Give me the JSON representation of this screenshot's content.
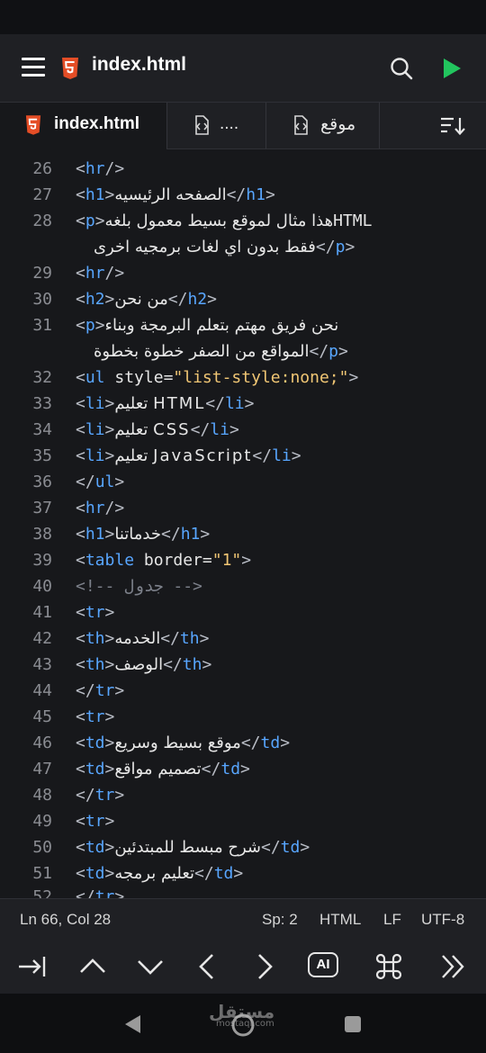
{
  "app_bar": {
    "title": "index.html",
    "menu_icon": "hamburger-menu-icon",
    "file_icon": "html5-icon",
    "search_icon": "search-icon",
    "run_icon": "play-icon"
  },
  "tabs": [
    {
      "label": "index.html",
      "icon": "html5-icon",
      "active": true
    },
    {
      "label": "....",
      "icon": "code-file-icon",
      "active": false
    },
    {
      "label": "موقع",
      "icon": "code-file-icon",
      "active": false
    }
  ],
  "sort_icon": "sort-icon",
  "editor": {
    "lines": [
      "26",
      "27",
      "28",
      "29",
      "30",
      "31",
      "32",
      "33",
      "34",
      "35",
      "36",
      "37",
      "38",
      "39",
      "40",
      "41",
      "42",
      "43",
      "44",
      "45",
      "46",
      "47",
      "48",
      "49",
      "50",
      "51",
      "52"
    ],
    "text": {
      "l27": "الصفحه الرئيسيه",
      "l28a": "هذا مثال لموقع بسيط معمول بلغه",
      "l28html": "HTML",
      "l28b": "فقط بدون اي لغات برمجيه اخرى",
      "l30": "من نحن",
      "l31a": "نحن فريق مهتم بتعلم البرمجة وبناء",
      "l31b": "المواقع من الصفر خطوة بخطوة",
      "l32_attr": "style",
      "l32_val": "\"list-style:none;\"",
      "l33": "تعليم HTML",
      "l34": "تعليم CSS",
      "l35": "تعليم JavaScript",
      "l38": "خدماتنا",
      "l39_attr": "border",
      "l39_val": "\"1\"",
      "l40": "<!-- جدول -->",
      "l42": "الخدمه",
      "l43": "الوصف",
      "l46": "موقع بسيط وسريع",
      "l47": "تصميم مواقع",
      "l50": "شرح مبسط للمبتدئين",
      "l51": "تعليم برمجه"
    }
  },
  "footer": {
    "position": "Ln 66, Col 28",
    "spaces": "Sp: 2",
    "language": "HTML",
    "line_ending": "LF",
    "encoding": "UTF-8"
  },
  "keyboard_bar": {
    "keys": [
      "tab-key-icon",
      "arrow-up-icon",
      "arrow-down-icon",
      "arrow-left-icon",
      "arrow-right-icon",
      "ai-button-icon",
      "command-icon",
      "more-icon"
    ],
    "ai_label": "AI"
  },
  "watermark": {
    "line1": "مستقل",
    "line2": "mostaql.com"
  },
  "colors": {
    "tag": "#58a6ff",
    "string": "#f0c674",
    "editor_bg": "#17181b",
    "run": "#22c55e",
    "html5": "#e44d26"
  }
}
